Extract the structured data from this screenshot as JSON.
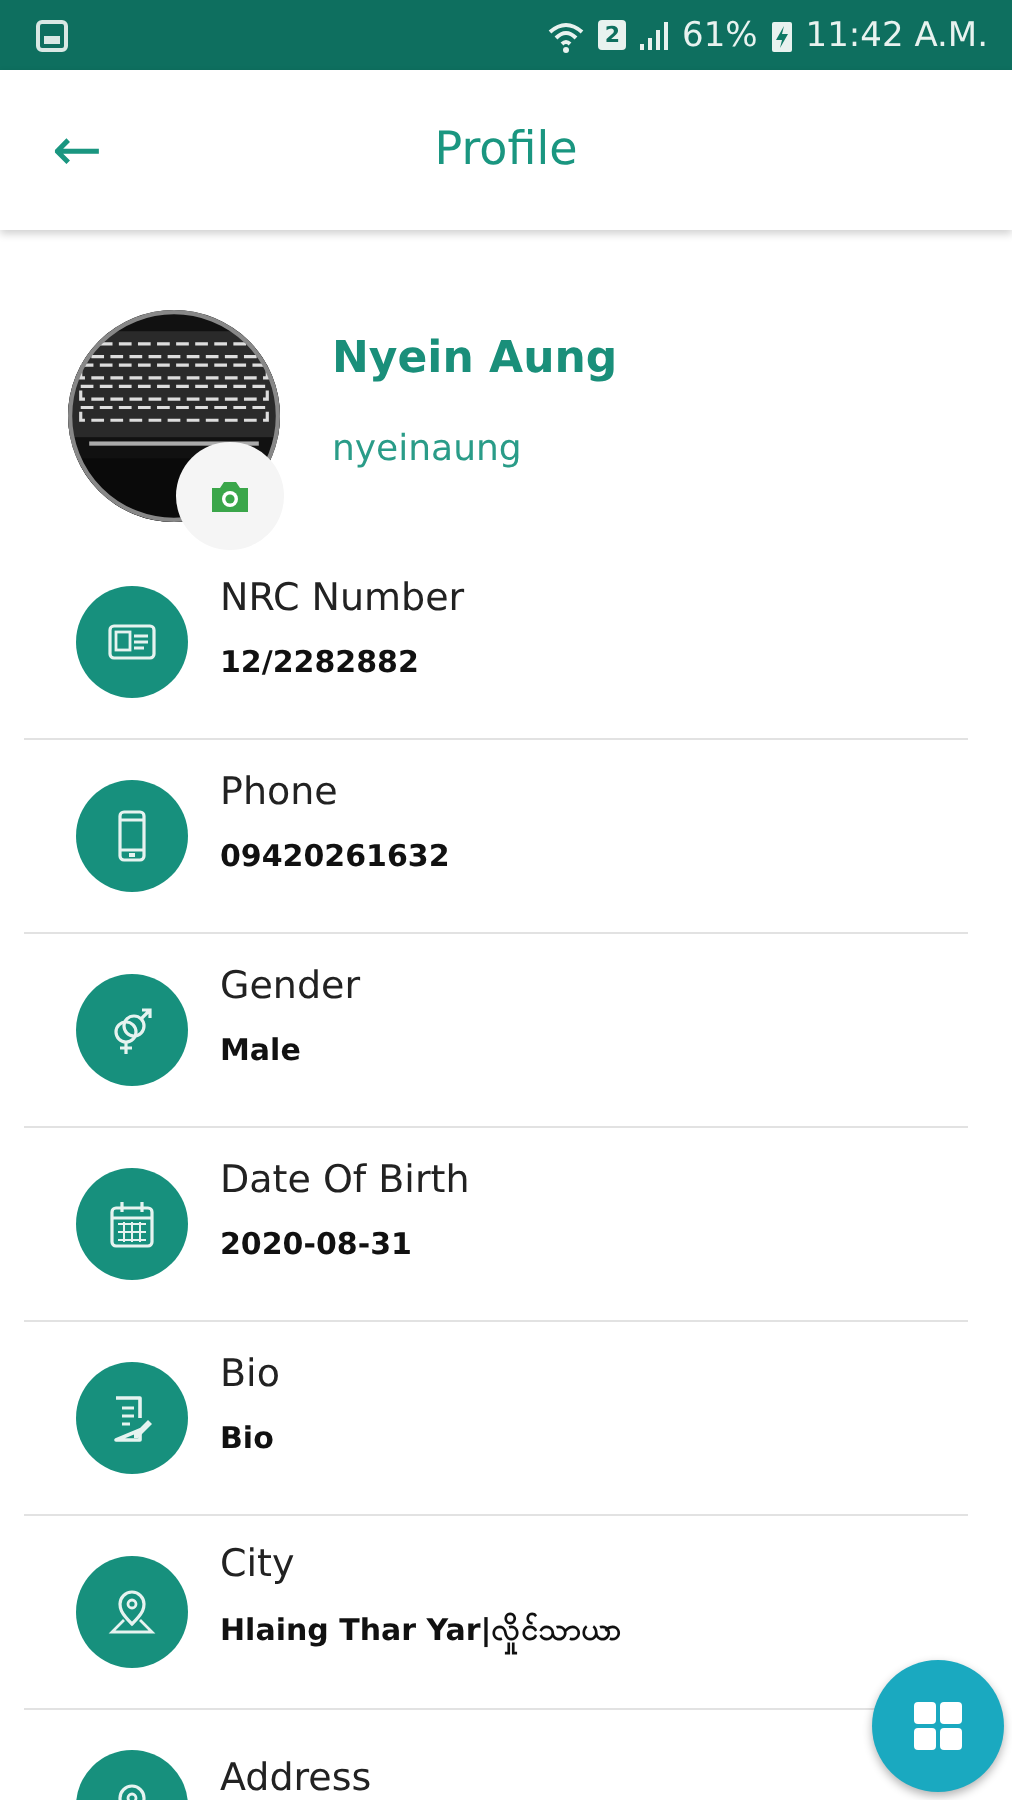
{
  "status_bar": {
    "sim": "2",
    "battery": "61%",
    "time": "11:42 A.M."
  },
  "app_bar": {
    "back": "←",
    "title": "Profile"
  },
  "profile": {
    "name": "Nyein Aung",
    "username": "nyeinaung"
  },
  "fields": [
    {
      "kind": "nrc",
      "label": "NRC Number",
      "value": "12/2282882"
    },
    {
      "kind": "phone",
      "label": "Phone",
      "value": "09420261632"
    },
    {
      "kind": "gender",
      "label": "Gender",
      "value": "Male"
    },
    {
      "kind": "date",
      "label": "Date Of Birth",
      "value": "2020-08-31"
    },
    {
      "kind": "bio",
      "label": "Bio",
      "value": "Bio"
    },
    {
      "kind": "city",
      "label": "City",
      "value": "Hlaing Thar Yar|လှိုင်သာယာ"
    },
    {
      "kind": "address",
      "label": "Address"
    }
  ]
}
